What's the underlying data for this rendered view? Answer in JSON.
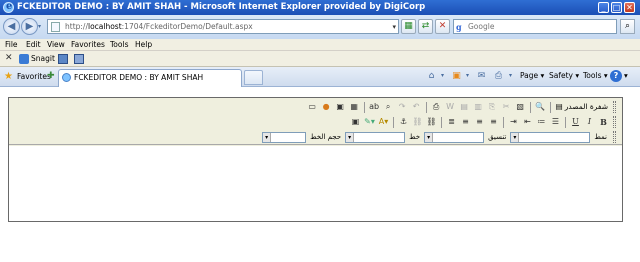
{
  "window": {
    "title": "FCKEDITOR DEMO : BY AMIT SHAH - Microsoft Internet Explorer provided by DigiCorp",
    "minimize": "_",
    "maximize": "□",
    "close": "✕"
  },
  "address": {
    "url_prefix": "http://",
    "url_host": "localhost",
    "url_rest": ":1704/FckeditorDemo/Default.aspx"
  },
  "search": {
    "placeholder": "Google",
    "engine_icon": "g"
  },
  "menu": [
    "File",
    "Edit",
    "View",
    "Favorites",
    "Tools",
    "Help"
  ],
  "links": {
    "close_glyph": "✕",
    "snagit_label": "Snagit"
  },
  "favorites_label": "Favorites",
  "tab": {
    "title": "FCKEDITOR DEMO : BY AMIT SHAH"
  },
  "commands": {
    "page": "Page",
    "safety": "Safety",
    "tools": "Tools",
    "help_glyph": "?"
  },
  "editor": {
    "source_label": "شفرة المصدر",
    "bold": "B",
    "italic": "I",
    "underline": "U",
    "style_label": "نمط",
    "format_label": "تنسيق",
    "font_label": "خط",
    "size_label": "حجم الخط"
  }
}
